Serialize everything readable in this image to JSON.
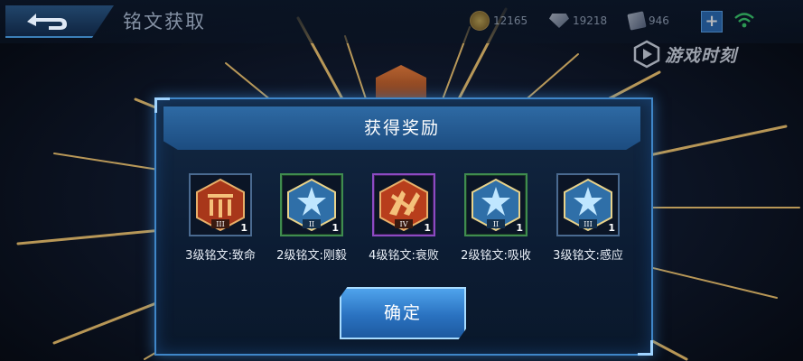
{
  "header": {
    "title": "铭文获取",
    "back_icon": "back-arrow-icon"
  },
  "resources": {
    "gold": "12165",
    "diamonds": "19218",
    "vouchers": "946"
  },
  "watermark": "游戏时刻",
  "modal": {
    "title": "获得奖励",
    "confirm_label": "确定",
    "rewards": [
      {
        "label": "3级铭文:致命",
        "tier": "III",
        "qty": "1",
        "color": "#c0451f"
      },
      {
        "label": "2级铭文:刚毅",
        "tier": "II",
        "qty": "1",
        "color": "#3a8fd0"
      },
      {
        "label": "4级铭文:衰败",
        "tier": "IV",
        "qty": "1",
        "color": "#c0451f"
      },
      {
        "label": "2级铭文:吸收",
        "tier": "II",
        "qty": "1",
        "color": "#3a8fd0"
      },
      {
        "label": "3级铭文:感应",
        "tier": "III",
        "qty": "1",
        "color": "#3a8fd0"
      }
    ]
  },
  "colors": {
    "accent": "#3f86c8",
    "button": "#2a72c0"
  }
}
